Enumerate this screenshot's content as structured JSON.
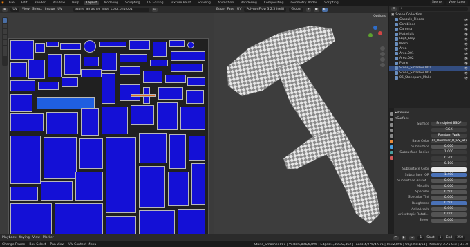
{
  "menu": [
    "File",
    "Edit",
    "Render",
    "Window",
    "Help"
  ],
  "workspaces": [
    "Layout",
    "Modeling",
    "Sculpting",
    "UV Editing",
    "Texture Paint",
    "Shading",
    "Animation",
    "Rendering",
    "Compositing",
    "Geometry Nodes",
    "Scripting"
  ],
  "active_workspace": "Layout",
  "scene": "Scene",
  "view_layer": "View Layer",
  "uv_header": {
    "mode": "UV",
    "items": [
      "View",
      "Select",
      "Image",
      "UV"
    ],
    "image_name": "Stone_Smasher_Base_color.png.001"
  },
  "view_header": {
    "items": [
      "Edge",
      "Face",
      "UV"
    ],
    "addon": "PolygonFlow 3.2.5 (self)",
    "transform": "Global",
    "options": "Options"
  },
  "outliner": {
    "title": "Scene Collection",
    "rows": [
      {
        "name": "Capsule_Pieces",
        "selected": false
      },
      {
        "name": "Combined",
        "selected": false
      },
      {
        "name": "Camera",
        "selected": false
      },
      {
        "name": "Materials",
        "selected": false
      },
      {
        "name": "High_Poly",
        "selected": false
      },
      {
        "name": "Mesh",
        "selected": false
      },
      {
        "name": "Area",
        "selected": false
      },
      {
        "name": "Area.001",
        "selected": false
      },
      {
        "name": "Area.002",
        "selected": false
      },
      {
        "name": "Plane",
        "selected": false
      },
      {
        "name": "Stone_Smasher.001",
        "selected": true
      },
      {
        "name": "Stone_Smasher.002",
        "selected": false
      },
      {
        "name": "06_Stonepare_Malle",
        "selected": false
      }
    ]
  },
  "properties": {
    "preview": "Preview",
    "surface": "Surface",
    "surface_value": "Principled BSDF",
    "distribution": "GGX",
    "subsurface_method": "Random Walk",
    "base_color_texture": "TT_Hammer_B_UV_DRB",
    "rows": [
      {
        "label": "Subsurface",
        "value": "0.000",
        "style": "normal"
      },
      {
        "label": "Subsurface Radius",
        "value": "1.000",
        "style": "plain"
      },
      {
        "label": "",
        "value": "0.200",
        "style": "plain"
      },
      {
        "label": "",
        "value": "0.100",
        "style": "plain"
      },
      {
        "label": "Subsurface Color",
        "value": "",
        "style": "white"
      },
      {
        "label": "Subsurface IOR",
        "value": "1.400",
        "style": "blue"
      },
      {
        "label": "Subsurface Anisot...",
        "value": "0.000",
        "style": "normal"
      },
      {
        "label": "Metallic",
        "value": "0.000",
        "style": "normal"
      },
      {
        "label": "Specular",
        "value": "0.500",
        "style": "normal"
      },
      {
        "label": "Specular Tint",
        "value": "0.000",
        "style": "normal"
      },
      {
        "label": "Roughness",
        "value": "0.500",
        "style": "blue"
      },
      {
        "label": "Anisotropic",
        "value": "0.000",
        "style": "normal"
      },
      {
        "label": "Anisotropic Rotati...",
        "value": "0.000",
        "style": "normal"
      },
      {
        "label": "Sheen",
        "value": "0.000",
        "style": "normal"
      }
    ]
  },
  "timeline": {
    "items": [
      "Playback",
      "Keying",
      "View",
      "Marker"
    ],
    "current_frame": "1",
    "start_label": "Start",
    "start": "1",
    "end_label": "End",
    "end": "250"
  },
  "status": {
    "left": [
      "Change Frame",
      "Box Select",
      "Pan View",
      "UV Context Menu"
    ],
    "right": "Stone_Smasher.001 | Verts:6,896/6,896 | Edges:1,46522,462 | Faces:4,975/4,975 | Tris:2,890 | Objects:1/14 | Memory: 2.75 GiB | 3.1.0"
  },
  "colors": {
    "island": "#1410d6",
    "island_selected": "#1f5fe0",
    "selection_row": "#334d80"
  }
}
